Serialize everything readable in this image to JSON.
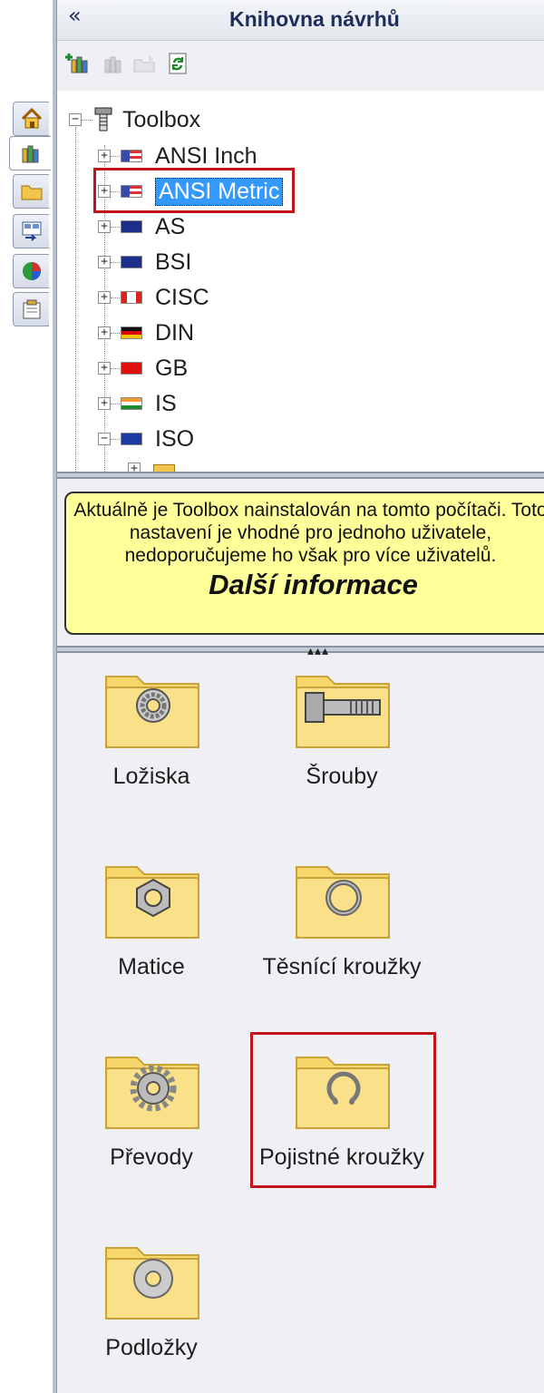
{
  "panel": {
    "title": "Knihovna návrhů",
    "collapse_label": "«"
  },
  "side_tabs": [
    {
      "icon": "home-icon"
    },
    {
      "icon": "design-library-icon"
    },
    {
      "icon": "file-explorer-icon"
    },
    {
      "icon": "view-palette-icon"
    },
    {
      "icon": "appearances-icon"
    },
    {
      "icon": "custom-properties-icon"
    }
  ],
  "toolbar": [
    {
      "icon": "add-to-library-icon",
      "enabled": true
    },
    {
      "icon": "add-file-location-icon",
      "enabled": false
    },
    {
      "icon": "create-new-folder-icon",
      "enabled": false
    },
    {
      "icon": "refresh-icon",
      "enabled": true
    }
  ],
  "tree": {
    "root": "Toolbox",
    "items": [
      {
        "label": "ANSI Inch",
        "selected": false,
        "expanded": false,
        "flag": "us"
      },
      {
        "label": "ANSI Metric",
        "selected": true,
        "expanded": false,
        "flag": "us"
      },
      {
        "label": "AS",
        "selected": false,
        "expanded": false,
        "flag": "au"
      },
      {
        "label": "BSI",
        "selected": false,
        "expanded": false,
        "flag": "uk"
      },
      {
        "label": "CISC",
        "selected": false,
        "expanded": false,
        "flag": "ca"
      },
      {
        "label": "DIN",
        "selected": false,
        "expanded": false,
        "flag": "de"
      },
      {
        "label": "GB",
        "selected": false,
        "expanded": false,
        "flag": "cn"
      },
      {
        "label": "IS",
        "selected": false,
        "expanded": false,
        "flag": "in"
      },
      {
        "label": "ISO",
        "selected": false,
        "expanded": true,
        "flag": "iso"
      }
    ]
  },
  "info": {
    "text": "Aktuálně je Toolbox nainstalován na tomto počítači. Toto nastavení je vhodné pro jednoho uživatele, nedoporučujeme ho však pro více uživatelů.",
    "link": "Další informace"
  },
  "folders": [
    {
      "label": "Ložiska",
      "icon": "bearing-icon",
      "highlighted": false
    },
    {
      "label": "Šrouby",
      "icon": "bolt-icon",
      "highlighted": false
    },
    {
      "label": "Matice",
      "icon": "nut-icon",
      "highlighted": false
    },
    {
      "label": "Těsnící kroužky",
      "icon": "o-ring-icon",
      "highlighted": false
    },
    {
      "label": "Převody",
      "icon": "gear-icon",
      "highlighted": false
    },
    {
      "label": "Pojistné kroužky",
      "icon": "retaining-ring-icon",
      "highlighted": true
    },
    {
      "label": "Podložky",
      "icon": "washer-icon",
      "highlighted": false
    }
  ],
  "colors": {
    "highlight": "#c0141b",
    "selection": "#3399ff",
    "info_background": "#ffff99"
  }
}
